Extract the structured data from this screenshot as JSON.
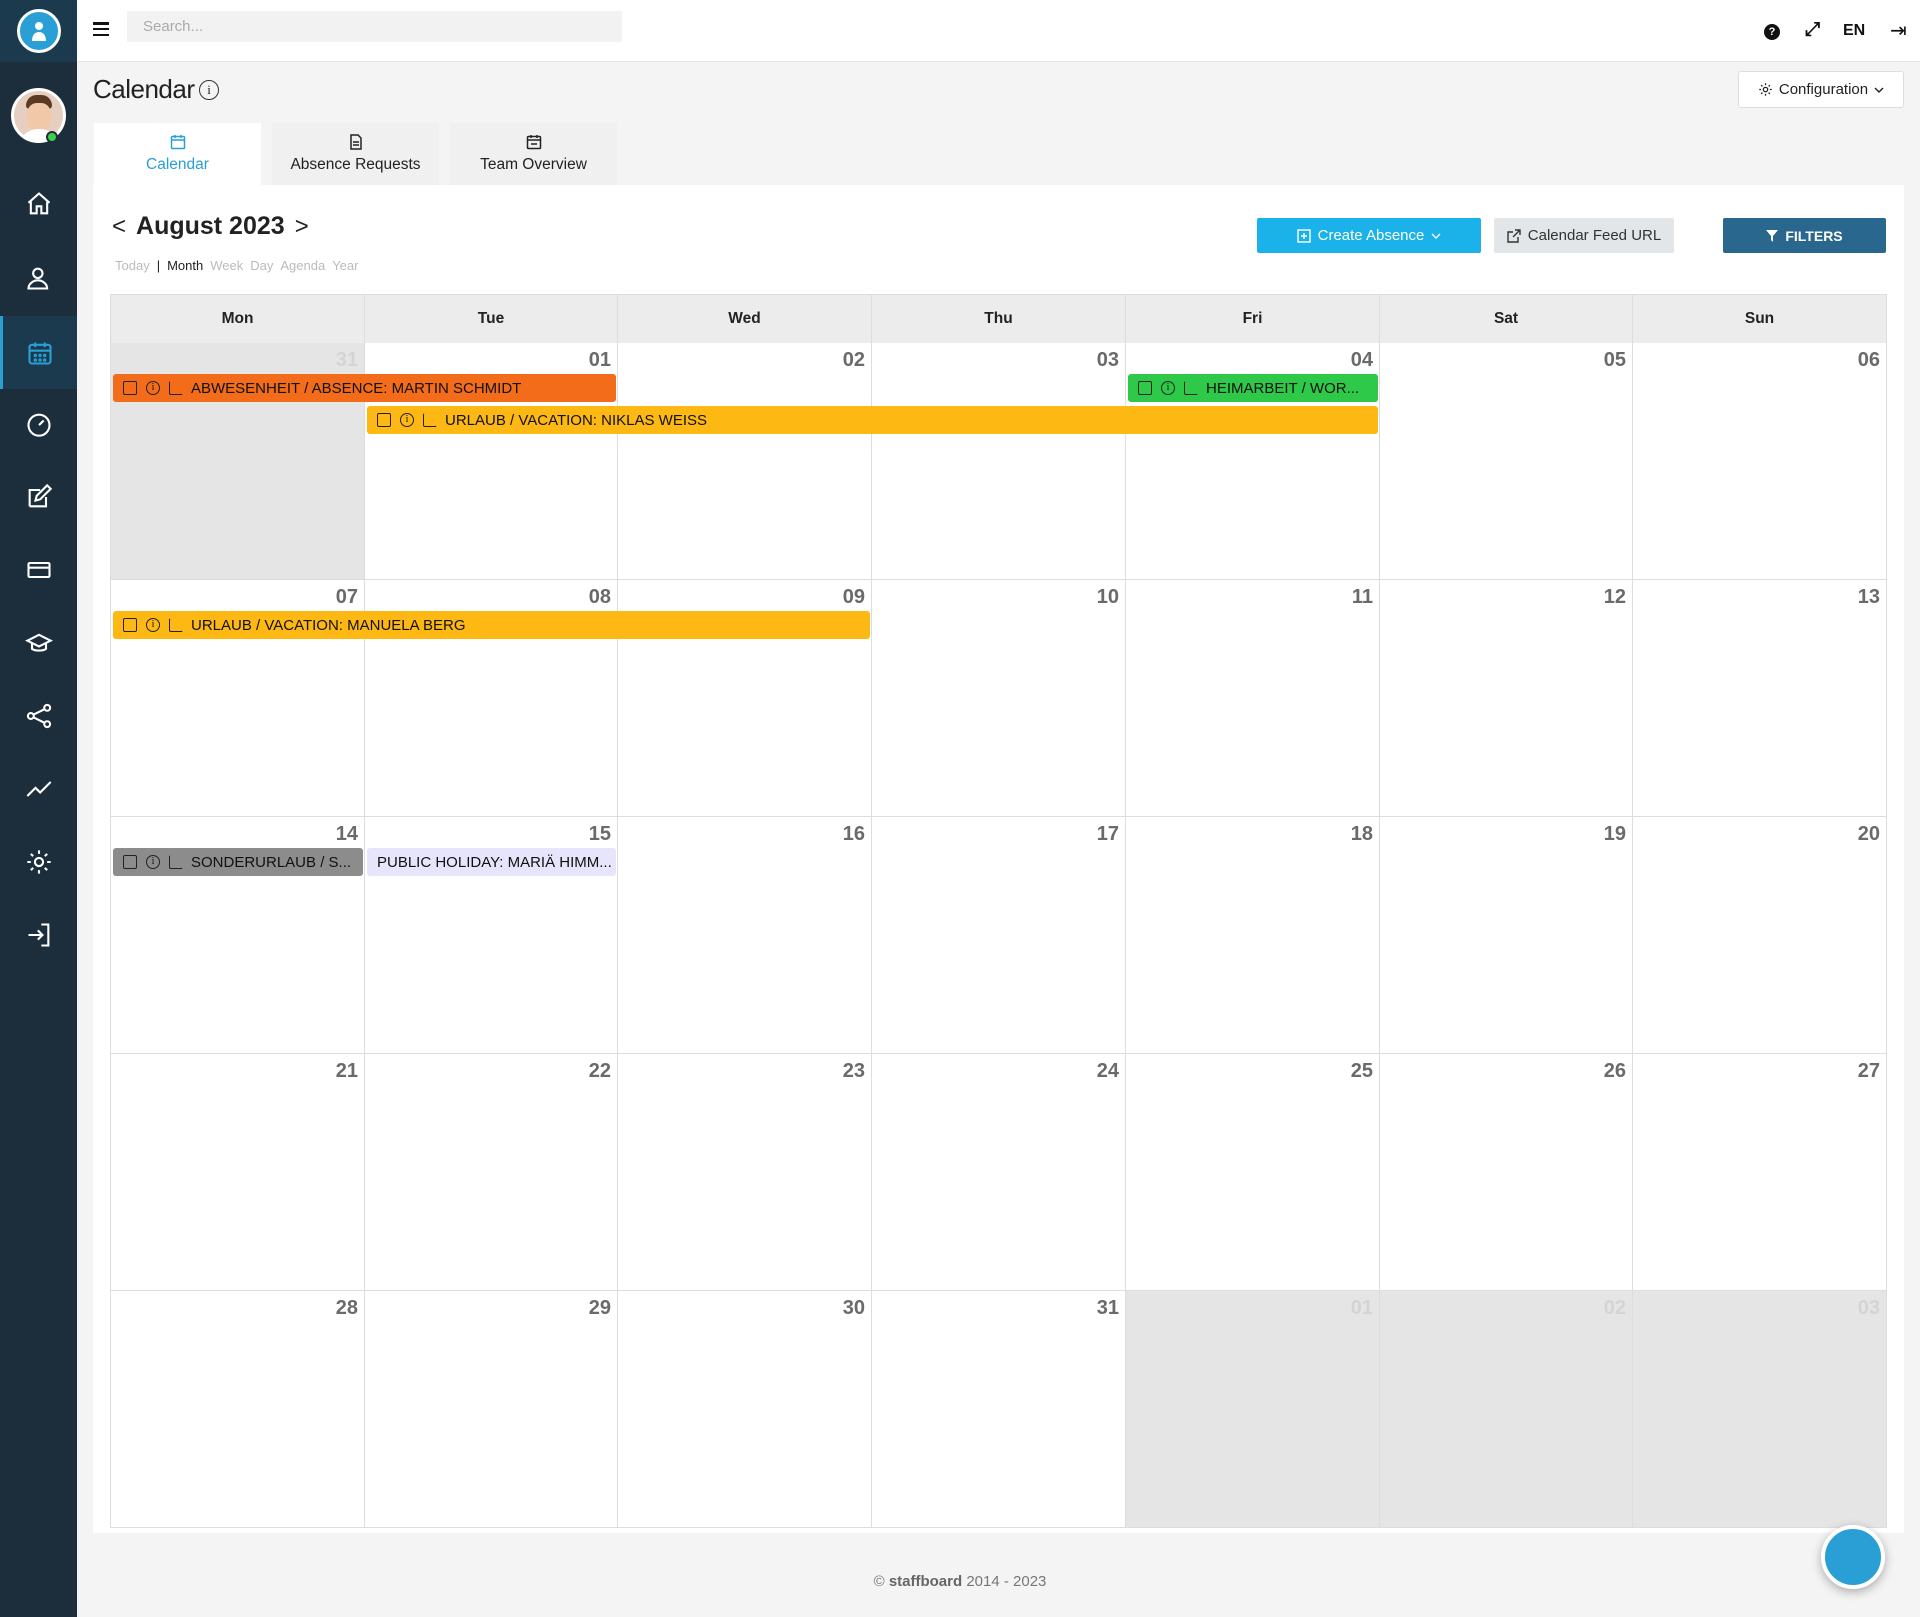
{
  "topbar": {
    "search_placeholder": "Search...",
    "help_icon": "?",
    "expand_icon": "⤢",
    "language": "EN",
    "logout_icon": "⇥"
  },
  "page": {
    "title": "Calendar",
    "config_label": "Configuration"
  },
  "tabs": [
    {
      "label": "Calendar",
      "icon": "calendar-icon",
      "active": true
    },
    {
      "label": "Absence Requests",
      "icon": "document-icon",
      "active": false
    },
    {
      "label": "Team Overview",
      "icon": "team-calendar-icon",
      "active": false
    }
  ],
  "calendar": {
    "month_label": "August 2023",
    "prev_arrow": "<",
    "next_arrow": ">",
    "views": [
      "Today",
      "Month",
      "Week",
      "Day",
      "Agenda",
      "Year"
    ],
    "active_view": "Month",
    "view_separator": "|",
    "create_label": "Create Absence",
    "feed_label": "Calendar Feed URL",
    "filters_label": "FILTERS",
    "weekdays": [
      "Mon",
      "Tue",
      "Wed",
      "Thu",
      "Fri",
      "Sat",
      "Sun"
    ],
    "weeks": [
      [
        "31",
        "01",
        "02",
        "03",
        "04",
        "05",
        "06"
      ],
      [
        "07",
        "08",
        "09",
        "10",
        "11",
        "12",
        "13"
      ],
      [
        "14",
        "15",
        "16",
        "17",
        "18",
        "19",
        "20"
      ],
      [
        "21",
        "22",
        "23",
        "24",
        "25",
        "26",
        "27"
      ],
      [
        "28",
        "29",
        "30",
        "31",
        "01",
        "02",
        "03"
      ]
    ],
    "events": [
      {
        "label": "ABWESENHEIT / ABSENCE: MARTIN SCHMIDT",
        "color": "#f26c1a",
        "icons": true
      },
      {
        "label": "HEIMARBEIT / WOR...",
        "color": "#2fc94a",
        "icons": true
      },
      {
        "label": "URLAUB / VACATION: NIKLAS WEISS",
        "color": "#fdb813",
        "icons": true
      },
      {
        "label": "URLAUB / VACATION: MANUELA BERG",
        "color": "#fdb813",
        "icons": true
      },
      {
        "label": "SONDERURLAUB / S...",
        "color": "#8c8c8c",
        "icons": true
      },
      {
        "label": "PUBLIC HOLIDAY: MARIÄ HIMM...",
        "color": "#e7e5fb",
        "icons": false
      }
    ]
  },
  "footer": {
    "copyright": "©",
    "brand": "staffboard",
    "years": "2014 - 2023"
  },
  "colors": {
    "sidebar": "#1c2e3c",
    "accent": "#2a9fd6",
    "create_button": "#1ab2e8",
    "filters_button": "#29678f"
  }
}
